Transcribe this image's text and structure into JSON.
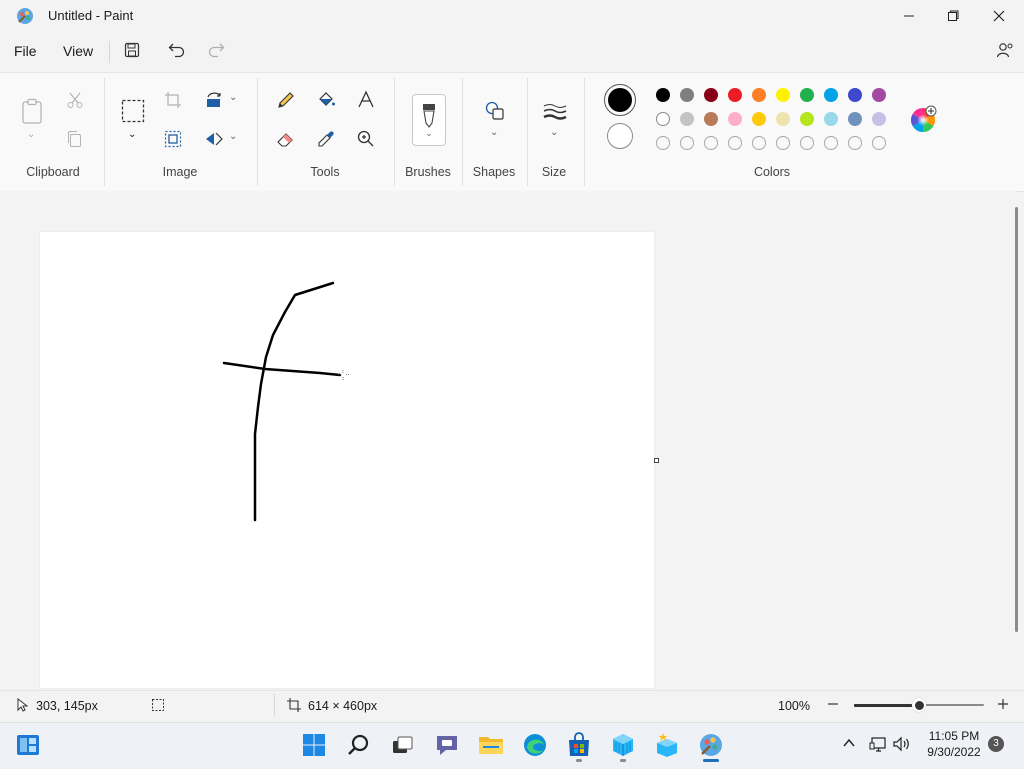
{
  "window": {
    "title": "Untitled - Paint",
    "app_icon": "paint-palette-icon",
    "controls": [
      "minimize-icon",
      "maximize-icon",
      "close-icon"
    ]
  },
  "menu": {
    "file": "File",
    "view": "View",
    "save_icon": "save-icon",
    "undo_icon": "undo-icon",
    "redo_icon": "redo-icon",
    "share_icon": "share-icon"
  },
  "ribbon": {
    "groups": {
      "clipboard": "Clipboard",
      "image": "Image",
      "tools": "Tools",
      "brushes": "Brushes",
      "shapes": "Shapes",
      "size": "Size",
      "colors": "Colors"
    },
    "primary_color": "#000000",
    "secondary_color": "#ffffff",
    "palette_row1": [
      "#000000",
      "#7f7f7f",
      "#880015",
      "#ed1c24",
      "#ff7f27",
      "#fff200",
      "#22b14c",
      "#00a2e8",
      "#3f48cc",
      "#a349a4"
    ],
    "palette_row2": [
      "#ffffff",
      "#c3c3c3",
      "#b97a57",
      "#ffaec9",
      "#ffc90e",
      "#efe4b0",
      "#b5e61d",
      "#99d9ea",
      "#7092be",
      "#c8bfe7"
    ],
    "palette_row3_count": 10
  },
  "status": {
    "cursor_position": "303, 145px",
    "canvas_size": "614 × 460px",
    "zoom": "100%",
    "zoom_level_fraction": 0.5
  },
  "taskbar": {
    "time": "11:05 PM",
    "date": "9/30/2022",
    "notification_count": "3",
    "apps": [
      "widgets-icon",
      "start-icon",
      "search-icon",
      "task-view-icon",
      "teams-chat-icon",
      "file-explorer-icon",
      "edge-icon",
      "store-icon",
      "app-blue-cube-icon",
      "app-cube-star-icon",
      "paint-icon"
    ]
  }
}
